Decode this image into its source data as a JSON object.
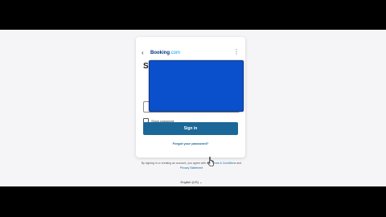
{
  "header": {
    "back_icon": "chevron-left-icon",
    "logo_text": "Booking",
    "logo_suffix": ".com",
    "more_icon": "vertical-dots-icon"
  },
  "form": {
    "title": "Sign in",
    "show_password_label": "Show password",
    "sign_in_label": "Sign in",
    "forgot_password_label": "Forgot your password?"
  },
  "footer": {
    "terms_prefix": "By signing in or creating an account, you agree with our",
    "terms_link": "Terms & Conditions",
    "terms_and": "and",
    "privacy_link": "Privacy Statement",
    "language": "English (US)"
  },
  "colors": {
    "brand": "#003580",
    "button": "#1b6898",
    "redaction": "#0a50cc"
  }
}
